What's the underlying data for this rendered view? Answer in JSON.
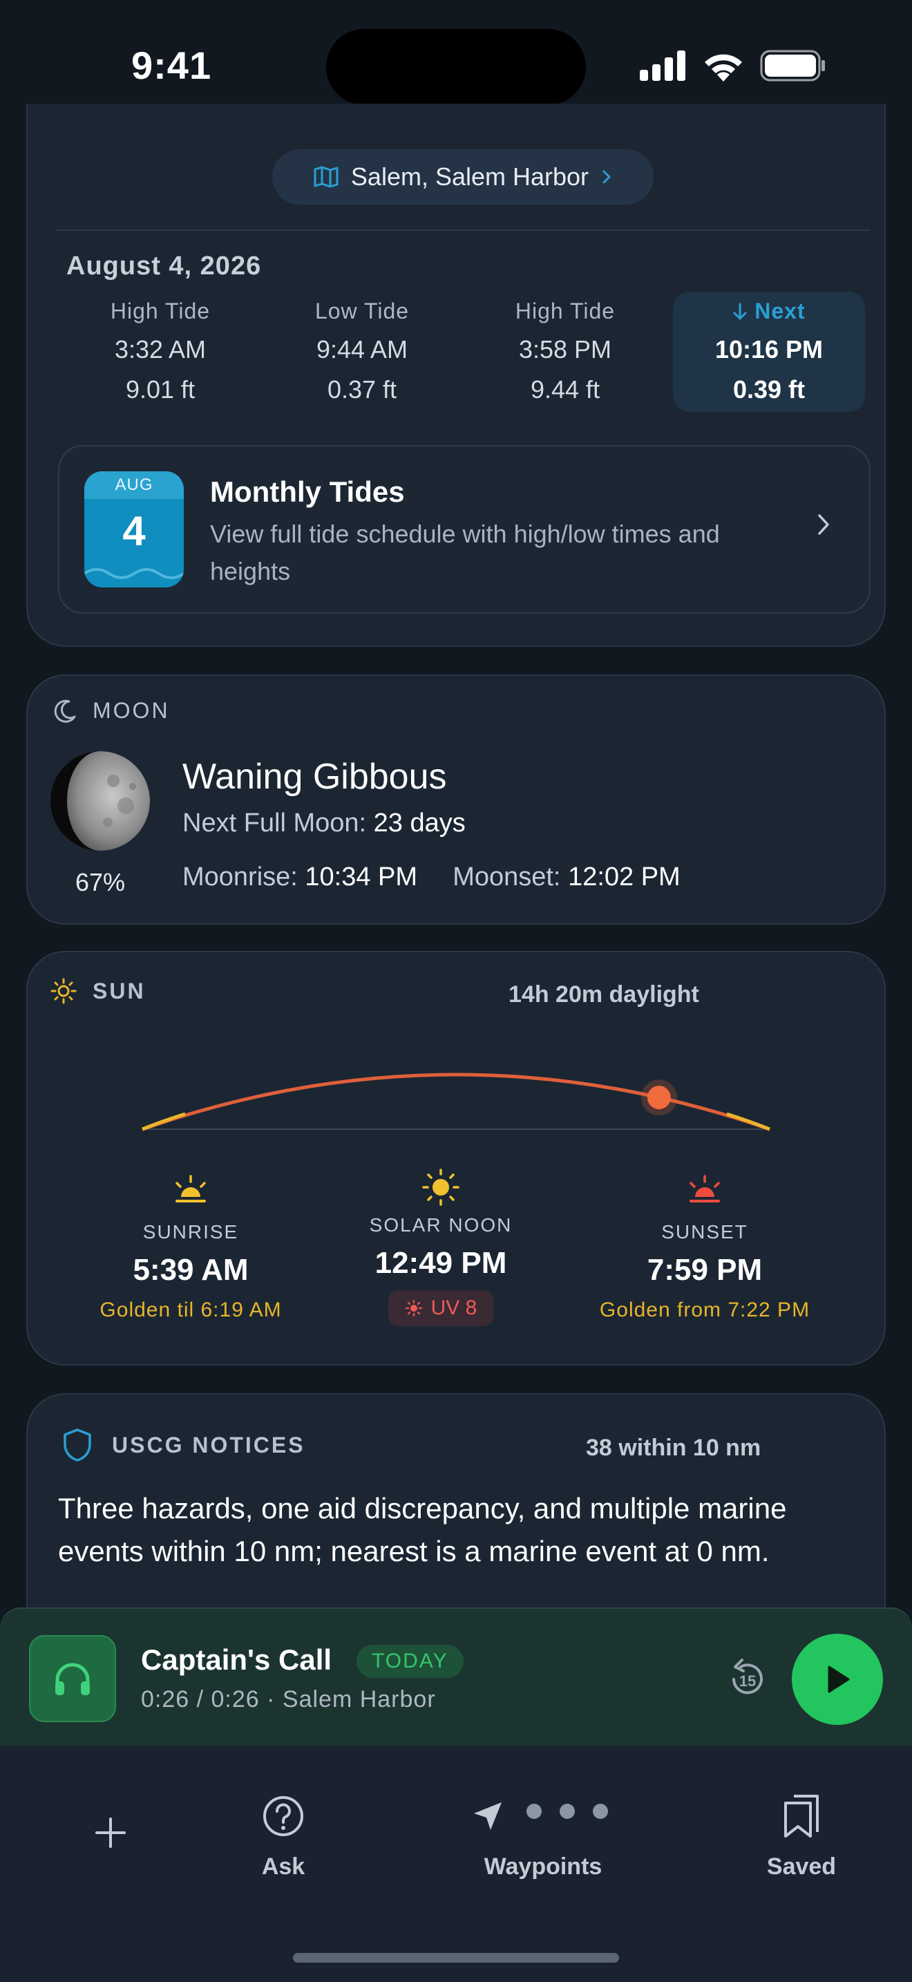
{
  "status_bar": {
    "time": "9:41"
  },
  "tides": {
    "location": "Salem, Salem Harbor",
    "date": "August 4, 2026",
    "entries": [
      {
        "type": "High Tide",
        "time": "3:32 AM",
        "height": "9.01 ft"
      },
      {
        "type": "Low Tide",
        "time": "9:44 AM",
        "height": "0.37 ft"
      },
      {
        "type": "High Tide",
        "time": "3:58 PM",
        "height": "9.44 ft"
      }
    ],
    "next": {
      "label": "Next",
      "time": "10:16 PM",
      "height": "0.39 ft"
    },
    "monthly": {
      "cal_month": "AUG",
      "cal_day": "4",
      "title": "Monthly Tides",
      "description": "View full tide schedule with high/low times and heights"
    }
  },
  "moon": {
    "section_label": "MOON",
    "illumination": "67%",
    "phase": "Waning Gibbous",
    "next_full_label": "Next Full Moon:",
    "next_full_value": "23 days",
    "moonrise_label": "Moonrise:",
    "moonrise_value": "10:34 PM",
    "moonset_label": "Moonset:",
    "moonset_value": "12:02 PM"
  },
  "sun": {
    "section_label": "SUN",
    "daylight": "14h 20m daylight",
    "sun_progress": 0.82,
    "sunrise": {
      "label": "SUNRISE",
      "time": "5:39 AM",
      "sub": "Golden til 6:19 AM"
    },
    "noon": {
      "label": "SOLAR NOON",
      "time": "12:49 PM",
      "uv": "UV 8"
    },
    "sunset": {
      "label": "SUNSET",
      "time": "7:59 PM",
      "sub": "Golden from 7:22 PM"
    },
    "colors": {
      "arc": "#e0603a",
      "golden": "#e9b52a",
      "sunset_icon": "#ef4b3f"
    }
  },
  "notices": {
    "section_label": "USCG NOTICES",
    "count": "38 within 10 nm",
    "summary": "Three hazards, one aid discrepancy, and multiple marine events within 10 nm; nearest is a marine event at 0 nm."
  },
  "player": {
    "title": "Captain's Call",
    "badge": "TODAY",
    "subtitle": "0:26 / 0:26 · Salem Harbor",
    "replay_seconds": "15"
  },
  "tabbar": {
    "add_icon": "plus-icon",
    "ask": "Ask",
    "waypoints": "Waypoints",
    "saved": "Saved"
  },
  "colors": {
    "accent_blue": "#2a9fd6",
    "accent_green": "#22c55e",
    "background": "#111820",
    "card": "#1c2633"
  }
}
